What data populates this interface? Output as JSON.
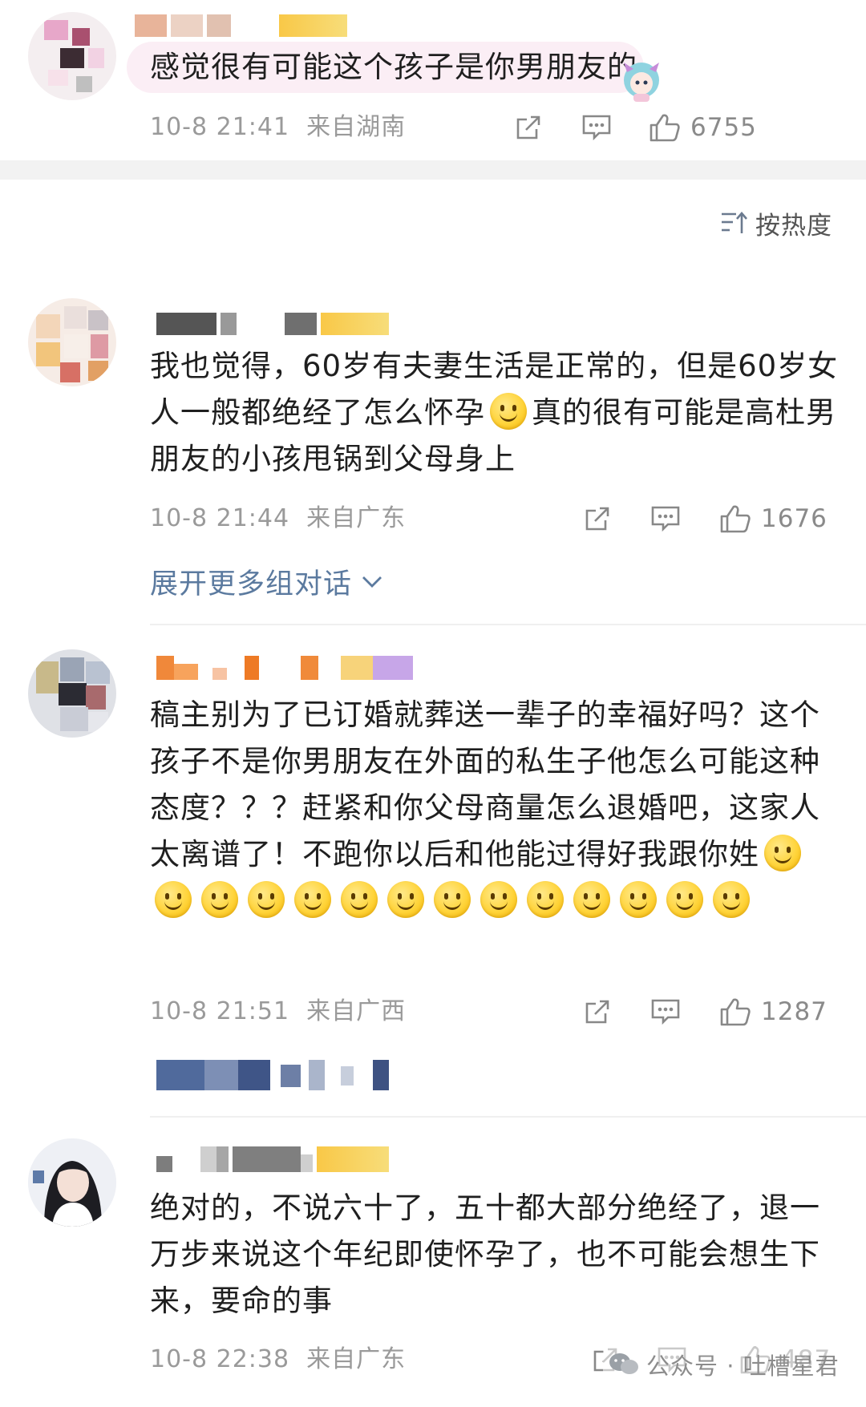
{
  "colors": {
    "link_blue": "#5b7a9f",
    "meta_gray": "#9a9a9a",
    "text": "#1f1f1f",
    "section_bg": "#f2f2f2"
  },
  "top_comment": {
    "text": "感觉很有可能这个孩子是你男朋友的",
    "time": "10-8 21:41",
    "location": "来自湖南",
    "likes": "6755"
  },
  "sort": {
    "icon": "sort-icon",
    "label": "按热度"
  },
  "comments": [
    {
      "text_parts": [
        "我也觉得，60岁有夫妻生活是正常的，但是60岁女人一般都绝经了怎么怀孕",
        "真的很有可能是高杜男朋友的小孩甩锅到父母身上"
      ],
      "time": "10-8 21:44",
      "location": "来自广东",
      "likes": "1676",
      "expand_label": "展开更多组对话"
    },
    {
      "text": "稿主别为了已订婚就葬送一辈子的幸福好吗？这个孩子不是你男朋友在外面的私生子他怎么可能这种态度？？？赶紧和你父母商量怎么退婚吧，这家人太离谱了！不跑你以后和他能过得好我跟你姓",
      "emoji_count": 14,
      "time": "10-8 21:51",
      "location": "来自广西",
      "likes": "1287"
    },
    {
      "text": "绝对的，不说六十了，五十都大部分绝经了，退一万步来说这个年纪即使怀孕了，也不可能会想生下来，要命的事",
      "time": "10-8 22:38",
      "location": "来自广东",
      "likes": "487"
    }
  ],
  "watermark": "公众号 · 吐槽星君"
}
